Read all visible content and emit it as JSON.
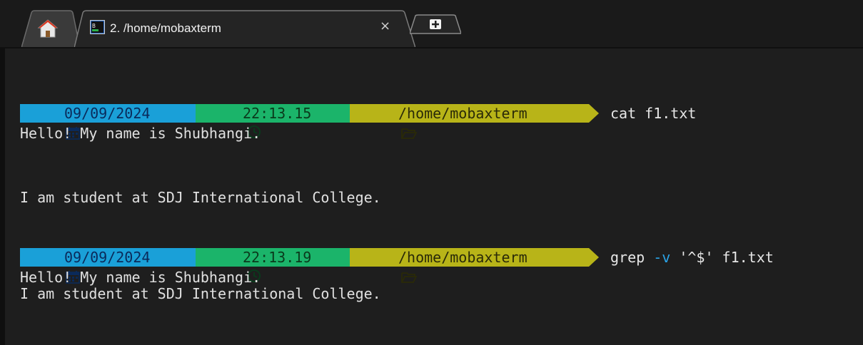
{
  "window": {
    "tab": {
      "title": "2. /home/mobaxterm",
      "close_glyph": "×"
    }
  },
  "icons": {
    "home": "home-icon",
    "terminal": "terminal-icon",
    "new_tab": "plus-icon",
    "calendar": "calendar-icon",
    "clock": "clock-icon",
    "folder": "folder-icon"
  },
  "colors": {
    "terminal_bg": "#1e1e1e",
    "date_segment": "#1aa0d8",
    "time_segment": "#1bb46a",
    "path_segment": "#b8b418",
    "flag_color": "#2aa4e8",
    "text": "#e0e0e0"
  },
  "terminal": {
    "prompt1": {
      "date": "09/09/2024",
      "time": "22:13.15",
      "path": "/home/mobaxterm",
      "command": "cat f1.txt"
    },
    "output1": [
      "Hello! My name is Shubhangi.",
      "",
      "",
      "I am student at SDJ International College."
    ],
    "prompt2": {
      "date": "09/09/2024",
      "time": "22:13.19",
      "path": "/home/mobaxterm",
      "command_pre": "grep ",
      "command_flag": "-v",
      "command_post": " '^$' f1.txt"
    },
    "output2": [
      "Hello! My name is Shubhangi.",
      "I am student at SDJ International College."
    ]
  }
}
